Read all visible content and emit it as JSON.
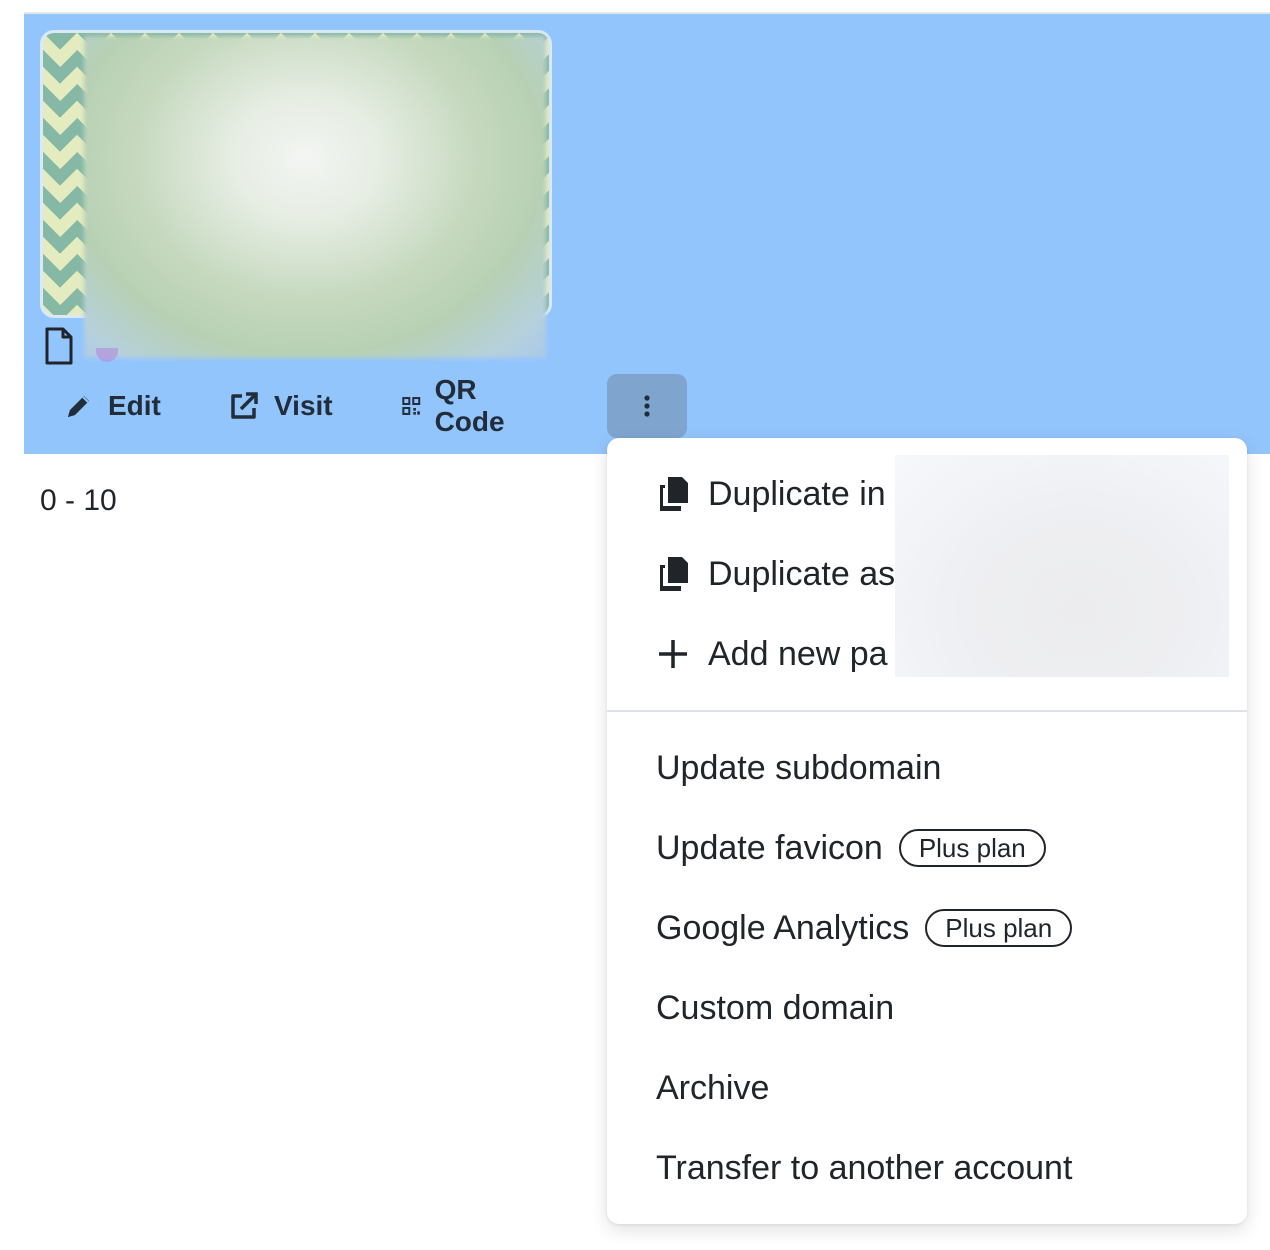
{
  "card": {
    "actions": {
      "edit_label": "Edit",
      "visit_label": "Visit",
      "qr_label": "QR Code"
    }
  },
  "pagination": {
    "range_label": "0 - 10"
  },
  "menu": {
    "items_top": [
      {
        "label": "Duplicate in",
        "icon": "copy-icon"
      },
      {
        "label": "Duplicate as",
        "icon": "copy-icon"
      },
      {
        "label": "Add new pa",
        "icon": "plus-icon"
      }
    ],
    "items_bottom": [
      {
        "label": "Update subdomain",
        "badge": ""
      },
      {
        "label": "Update favicon",
        "badge": "Plus plan"
      },
      {
        "label": "Google Analytics",
        "badge": "Plus plan"
      },
      {
        "label": "Custom domain",
        "badge": ""
      },
      {
        "label": "Archive",
        "badge": ""
      },
      {
        "label": "Transfer to another account",
        "badge": ""
      }
    ]
  },
  "colors": {
    "card_background": "#93c5fd",
    "more_button_active": "#7fa5cf",
    "text": "#212529"
  }
}
